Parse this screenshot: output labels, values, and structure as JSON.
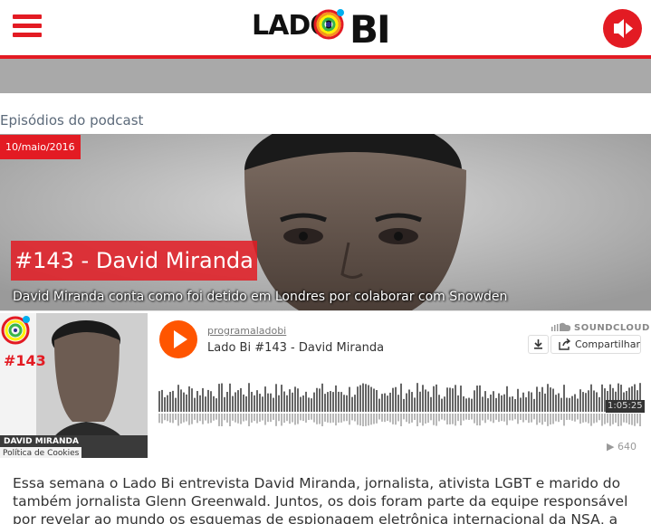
{
  "header": {
    "logo_left": "LADO",
    "logo_right": "BI",
    "brand_color": "#e31b23"
  },
  "section": {
    "title": "Episódios do podcast"
  },
  "episode": {
    "date": "10/maio/2016",
    "title": "#143 - David Miranda",
    "subtitle": "David Miranda conta como foi detido em Londres por colaborar com Snowden"
  },
  "player": {
    "artwork_number": "#143",
    "artwork_name": "DAVID MIRANDA",
    "cookie_label": "Política de Cookies",
    "username": "programaladobi",
    "track": "Lado Bi #143 - David Miranda",
    "brand": "SOUNDCLOUD",
    "share_label": "Compartilhar",
    "duration": "1:05:25",
    "plays": "640",
    "accent": "#ff5500"
  },
  "article": {
    "text": "Essa semana o Lado Bi entrevista David Miranda, jornalista, ativista LGBT e marido do também jornalista Glenn Greenwald. Juntos, os dois foram parte da equipe responsável por revelar ao mundo os esquemas de espionagem eletrônica internacional da NSA, a agência"
  },
  "icons": {
    "menu": "hamburger-icon",
    "podcast": "podcast-icon",
    "play": "play-icon",
    "download": "download-icon",
    "share": "share-icon"
  }
}
